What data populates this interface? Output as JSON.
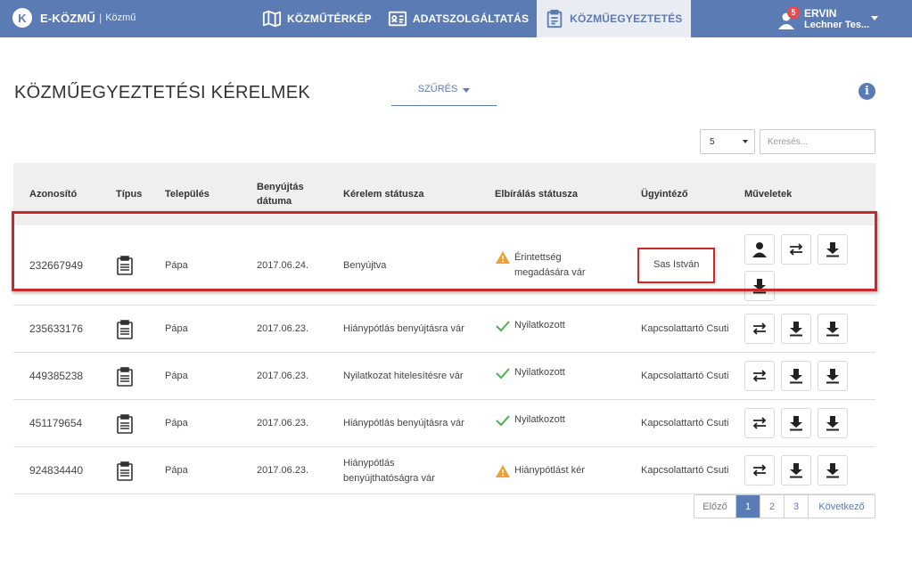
{
  "brand": {
    "logo": "K",
    "name": "E-KÖZMŰ",
    "sub": "Közmű"
  },
  "nav": [
    {
      "label": "KÖZMŰTÉRKÉP",
      "icon": "map-icon"
    },
    {
      "label": "ADATSZOLGÁLTATÁS",
      "icon": "id-card-icon"
    },
    {
      "label": "KÖZMŰEGYEZTETÉS",
      "icon": "clipboard-icon",
      "active": true
    }
  ],
  "user": {
    "badge": "5",
    "name": "ERVIN",
    "org": "Lechner Tes..."
  },
  "page": {
    "title": "KÖZMŰEGYEZTETÉSI KÉRELMEK",
    "filter_label": "SZŰRÉS"
  },
  "controls": {
    "page_size": "5",
    "search_placeholder": "Keresés..."
  },
  "table": {
    "headers": [
      "Azonosító",
      "Típus",
      "Település",
      "Benyújtás dátuma",
      "Kérelem státusza",
      "Elbírálás státusza",
      "Ügyintéző",
      "Műveletek"
    ],
    "rows": [
      {
        "id": "232667949",
        "settlement": "Pápa",
        "date": "2017.06.24.",
        "status": "Benyújtva",
        "review": "Érintettség megadására vár",
        "review_icon": "warning",
        "assignee": "Sas István",
        "actions": [
          "user-icon",
          "transfer-icon",
          "download-icon",
          "download-icon"
        ]
      },
      {
        "id": "235633176",
        "settlement": "Pápa",
        "date": "2017.06.23.",
        "status": "Hiánypótlás benyújtásra vár",
        "review": "Nyilatkozott",
        "review_icon": "check",
        "assignee": "Kapcsolattartó Csuti",
        "actions": [
          "transfer-icon",
          "download-icon",
          "download-icon"
        ]
      },
      {
        "id": "449385238",
        "settlement": "Pápa",
        "date": "2017.06.23.",
        "status": "Nyilatkozat hitelesítésre vár",
        "review": "Nyilatkozott",
        "review_icon": "check",
        "assignee": "Kapcsolattartó Csuti",
        "actions": [
          "transfer-icon",
          "download-icon",
          "download-icon"
        ]
      },
      {
        "id": "451179654",
        "settlement": "Pápa",
        "date": "2017.06.23.",
        "status": "Hiánypótlás benyújtásra vár",
        "review": "Nyilatkozott",
        "review_icon": "check",
        "assignee": "Kapcsolattartó Csuti",
        "actions": [
          "transfer-icon",
          "download-icon",
          "download-icon"
        ]
      },
      {
        "id": "924834440",
        "settlement": "Pápa",
        "date": "2017.06.23.",
        "status": "Hiánypótlás benyújthatóságra vár",
        "review": "Hiánypótlást kér",
        "review_icon": "warning",
        "assignee": "Kapcsolattartó Csuti",
        "actions": [
          "transfer-icon",
          "download-icon",
          "download-icon"
        ]
      }
    ]
  },
  "pagination": {
    "prev": "Előző",
    "pages": [
      "1",
      "2",
      "3"
    ],
    "current": "1",
    "next": "Következő"
  },
  "colors": {
    "primary": "#5b7bb4",
    "warning": "#f0a030",
    "success": "#4caf50",
    "highlight": "#c82a2a"
  }
}
